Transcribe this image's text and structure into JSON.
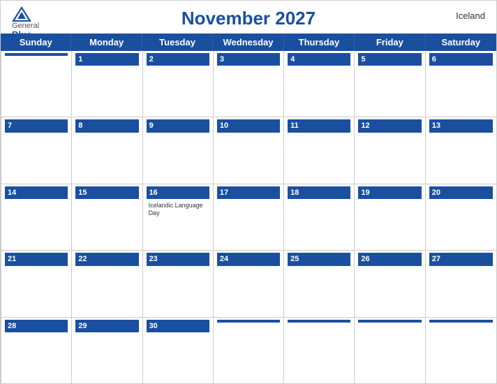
{
  "header": {
    "title": "November 2027",
    "country": "Iceland",
    "logo": {
      "general": "General",
      "blue": "Blue"
    }
  },
  "dayHeaders": [
    "Sunday",
    "Monday",
    "Tuesday",
    "Wednesday",
    "Thursday",
    "Friday",
    "Saturday"
  ],
  "weeks": [
    [
      {
        "day": "",
        "events": []
      },
      {
        "day": "1",
        "events": []
      },
      {
        "day": "2",
        "events": []
      },
      {
        "day": "3",
        "events": []
      },
      {
        "day": "4",
        "events": []
      },
      {
        "day": "5",
        "events": []
      },
      {
        "day": "6",
        "events": []
      }
    ],
    [
      {
        "day": "7",
        "events": []
      },
      {
        "day": "8",
        "events": []
      },
      {
        "day": "9",
        "events": []
      },
      {
        "day": "10",
        "events": []
      },
      {
        "day": "11",
        "events": []
      },
      {
        "day": "12",
        "events": []
      },
      {
        "day": "13",
        "events": []
      }
    ],
    [
      {
        "day": "14",
        "events": []
      },
      {
        "day": "15",
        "events": []
      },
      {
        "day": "16",
        "events": [
          "Icelandic Language Day"
        ]
      },
      {
        "day": "17",
        "events": []
      },
      {
        "day": "18",
        "events": []
      },
      {
        "day": "19",
        "events": []
      },
      {
        "day": "20",
        "events": []
      }
    ],
    [
      {
        "day": "21",
        "events": []
      },
      {
        "day": "22",
        "events": []
      },
      {
        "day": "23",
        "events": []
      },
      {
        "day": "24",
        "events": []
      },
      {
        "day": "25",
        "events": []
      },
      {
        "day": "26",
        "events": []
      },
      {
        "day": "27",
        "events": []
      }
    ],
    [
      {
        "day": "28",
        "events": []
      },
      {
        "day": "29",
        "events": []
      },
      {
        "day": "30",
        "events": []
      },
      {
        "day": "",
        "events": []
      },
      {
        "day": "",
        "events": []
      },
      {
        "day": "",
        "events": []
      },
      {
        "day": "",
        "events": []
      }
    ]
  ]
}
